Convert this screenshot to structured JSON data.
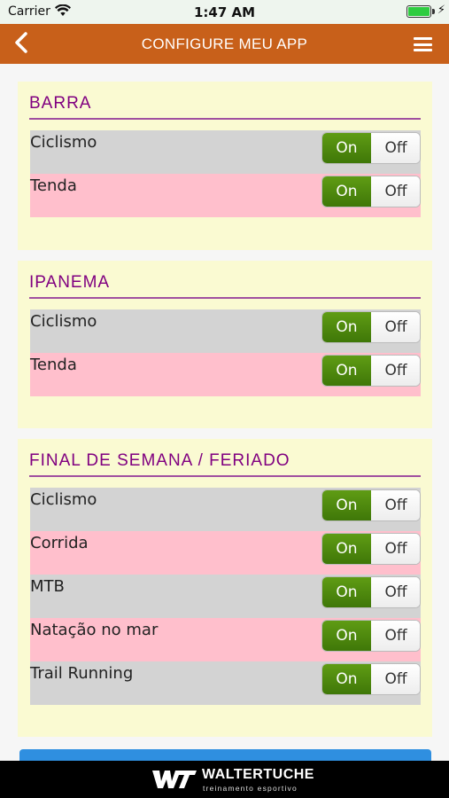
{
  "status_bar": {
    "carrier": "Carrier",
    "time": "1:47 AM"
  },
  "nav": {
    "title": "CONFIGURE MEU APP"
  },
  "toggle": {
    "on_label": "On",
    "off_label": "Off"
  },
  "sections": [
    {
      "title": "BARRA",
      "items": [
        {
          "label": "Ciclismo",
          "state": "On"
        },
        {
          "label": "Tenda",
          "state": "On"
        }
      ]
    },
    {
      "title": "IPANEMA",
      "items": [
        {
          "label": "Ciclismo",
          "state": "On"
        },
        {
          "label": "Tenda",
          "state": "On"
        }
      ]
    },
    {
      "title": "FINAL DE SEMANA / FERIADO",
      "items": [
        {
          "label": "Ciclismo",
          "state": "On"
        },
        {
          "label": "Corrida",
          "state": "On"
        },
        {
          "label": "MTB",
          "state": "On"
        },
        {
          "label": "Natação no mar",
          "state": "On"
        },
        {
          "label": "Trail Running",
          "state": "On"
        }
      ]
    }
  ],
  "footer": {
    "brand": "WALTERTUCHE",
    "tagline": "treinamento esportivo"
  },
  "colors": {
    "nav": "#c8601a",
    "card": "#fafad2",
    "title": "#800080",
    "row_gray": "#d3d3d3",
    "row_pink": "#ffbfcc",
    "toggle_on": "#4f8a10"
  }
}
